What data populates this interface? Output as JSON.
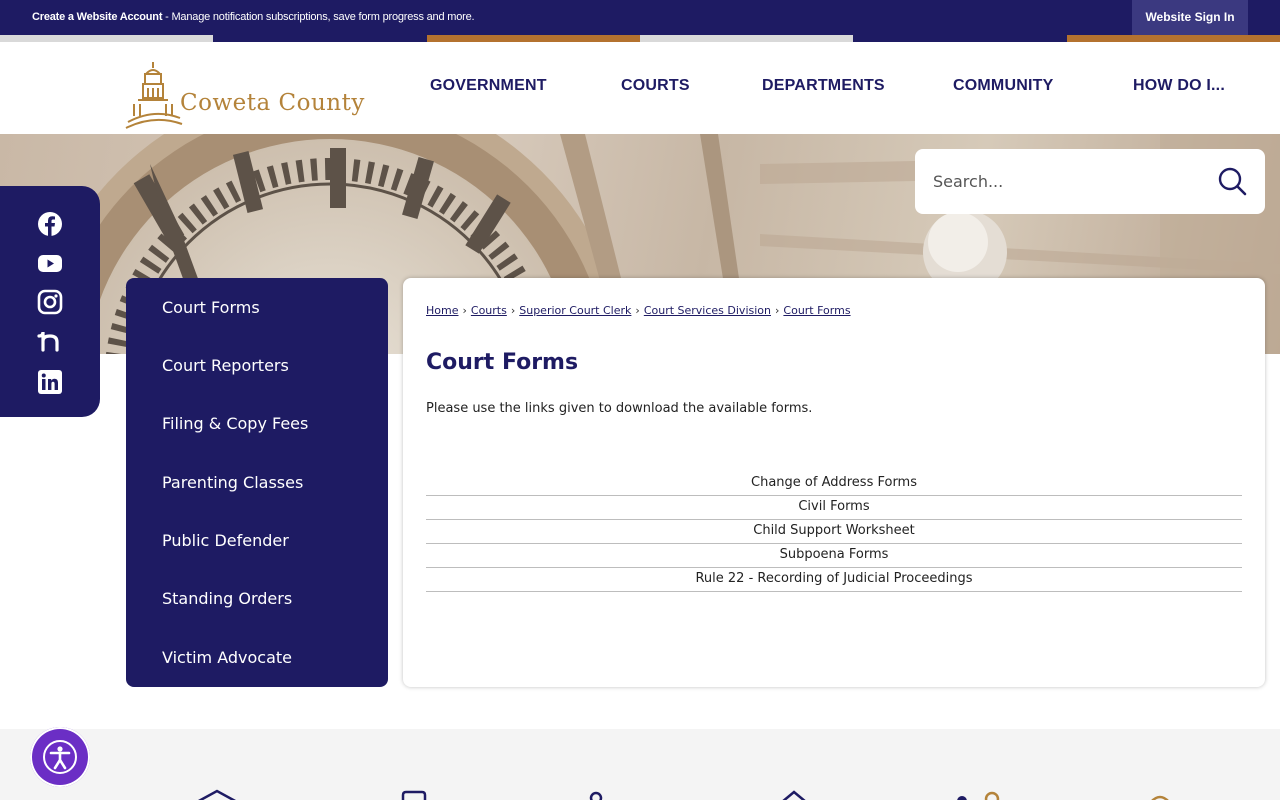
{
  "topbar": {
    "message_bold": "Create a Website Account",
    "message_rest": " - Manage notification subscriptions, save form progress and more.",
    "signin_label": "Website Sign In"
  },
  "stripe_colors": [
    "#d9d9d9",
    "#1e1b63",
    "#b4722f",
    "#d9d9d9",
    "#1e1b63",
    "#b4722f"
  ],
  "logo": {
    "text": "Coweta County"
  },
  "nav": {
    "items": [
      "GOVERNMENT",
      "COURTS",
      "DEPARTMENTS",
      "COMMUNITY",
      "HOW DO I..."
    ]
  },
  "search": {
    "placeholder": "Search..."
  },
  "social": {
    "icons": [
      "facebook-icon",
      "youtube-icon",
      "instagram-icon",
      "nextdoor-icon",
      "linkedin-icon"
    ]
  },
  "sidenav": {
    "items": [
      "Court Forms",
      "Court Reporters",
      "Filing & Copy Fees",
      "Parenting Classes",
      "Public Defender",
      "Standing Orders",
      "Victim Advocate"
    ]
  },
  "breadcrumb": {
    "items": [
      "Home",
      "Courts",
      "Superior Court Clerk",
      "Court Services Division",
      "Court Forms"
    ],
    "separator": "›"
  },
  "main": {
    "title": "Court Forms",
    "intro": "Please use the links given to download the available forms.",
    "forms": [
      "Change of Address Forms",
      "Civil Forms",
      "Child Support Worksheet",
      "Subpoena Forms",
      "Rule 22 - Recording of Judicial Proceedings"
    ]
  },
  "colors": {
    "navy": "#1e1b63",
    "gold": "#b4833a",
    "accessibility": "#6b2ec5"
  }
}
